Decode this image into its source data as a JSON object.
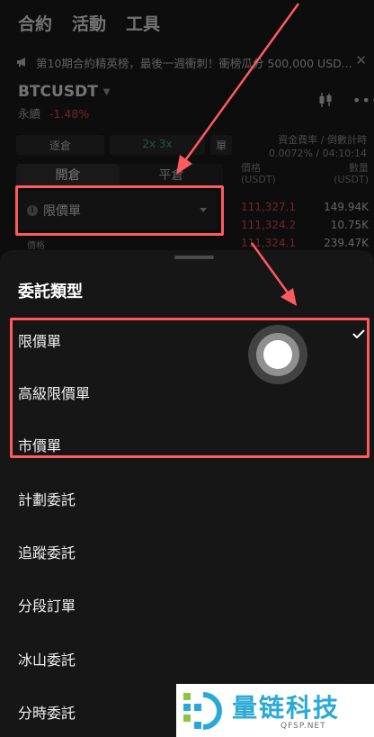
{
  "nav": {
    "tabs": [
      "合約",
      "活動",
      "工具"
    ]
  },
  "banner": {
    "text": "第10期合約精英榜，最後一週衝刺！衝榜瓜分 500,000 USD...",
    "close": "✕"
  },
  "pair": {
    "symbol": "BTCUSDT",
    "type": "永續",
    "change": "-1.48%"
  },
  "mode": {
    "margin": "逐倉",
    "leverage": "2x 3x",
    "single": "單"
  },
  "funding": {
    "label": "資金費率 / 倒數計時",
    "value": "0.0072% / 04:10:14"
  },
  "trade_tabs": {
    "open": "開倉",
    "close": "平倉"
  },
  "orderbook": {
    "price_header": "價格",
    "price_unit": "(USDT)",
    "qty_header": "數量",
    "qty_unit": "(USDT)",
    "rows": [
      {
        "price": "111,327.1",
        "qty": "149.94K"
      },
      {
        "price": "111,324.2",
        "qty": "10.75K"
      },
      {
        "price": "111,324.1",
        "qty": "239.47K"
      }
    ]
  },
  "order_type": {
    "selected": "限價單",
    "price_label": "價格"
  },
  "sheet": {
    "title": "委託類型",
    "options": [
      {
        "label": "限價單",
        "selected": true
      },
      {
        "label": "高級限價單",
        "selected": false
      },
      {
        "label": "市價單",
        "selected": false
      },
      {
        "label": "計劃委託",
        "selected": false
      },
      {
        "label": "追蹤委託",
        "selected": false
      },
      {
        "label": "分段訂單",
        "selected": false
      },
      {
        "label": "冰山委託",
        "selected": false
      },
      {
        "label": "分時委託",
        "selected": false
      }
    ]
  },
  "watermark": {
    "name": "量链科技",
    "url": "QFSP.NET"
  },
  "colors": {
    "accent_red": "#ff5a5f",
    "down": "#f6465d",
    "up": "#2ebd85",
    "brand": "#2aa9d6"
  }
}
